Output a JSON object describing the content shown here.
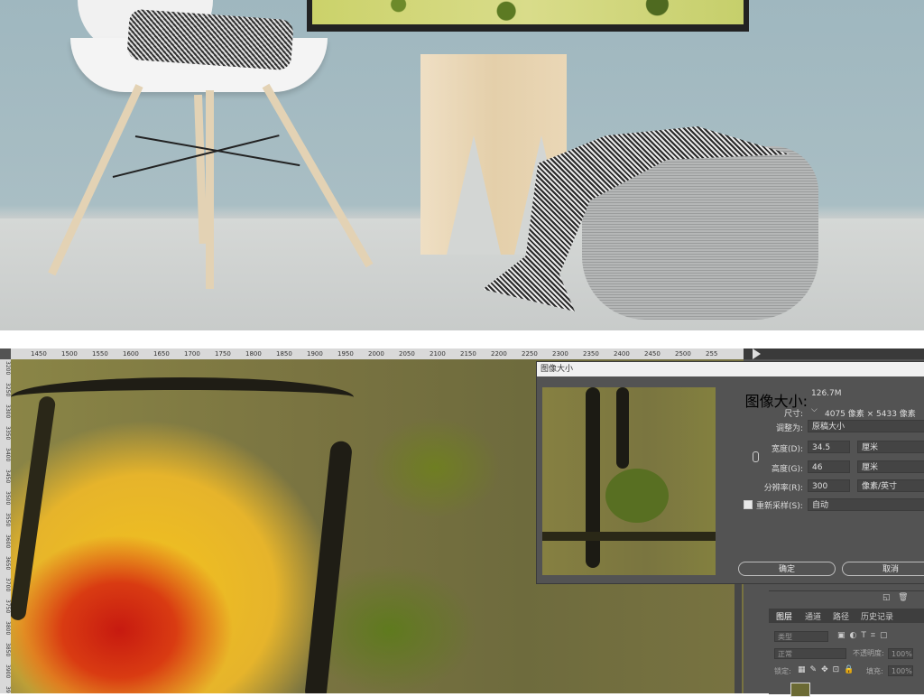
{
  "ruler": {
    "top_ticks": [
      "1450",
      "1500",
      "1550",
      "1600",
      "1650",
      "1700",
      "1750",
      "1800",
      "1850",
      "1900",
      "1950",
      "2000",
      "2050",
      "2100",
      "2150",
      "2200",
      "2250",
      "2300",
      "2350",
      "2400",
      "2450",
      "2500",
      "255"
    ],
    "left_ticks": [
      "3200",
      "3250",
      "3300",
      "3350",
      "3400",
      "3450",
      "3500",
      "3550",
      "3600",
      "3650",
      "3700",
      "3750",
      "3800",
      "3850",
      "3900",
      "3950"
    ]
  },
  "dialog": {
    "title": "图像大小",
    "image_size_label": "图像大小:",
    "image_size_value": "126.7M",
    "dimensions_label": "尺寸:",
    "dimensions_value": "4075 像素 × 5433 像素",
    "fit_label": "调整为:",
    "fit_value": "原稿大小",
    "width_label": "宽度(D):",
    "width_value": "34.5",
    "width_unit": "厘米",
    "height_label": "高度(G):",
    "height_value": "46",
    "height_unit": "厘米",
    "resolution_label": "分辨率(R):",
    "resolution_value": "300",
    "resolution_unit": "像素/英寸",
    "resample_label": "重新采样(S):",
    "resample_value": "自动",
    "resample_checked": true,
    "ok_label": "确定",
    "cancel_label": "取消"
  },
  "layers_panel": {
    "tabs": [
      "图层",
      "通道",
      "路径",
      "历史记录"
    ],
    "filter_placeholder": "类型",
    "blend_mode": "正常",
    "opacity_label": "不透明度:",
    "opacity_value": "100%",
    "lock_label": "锁定:",
    "fill_label": "填充:",
    "fill_value": "100%"
  }
}
